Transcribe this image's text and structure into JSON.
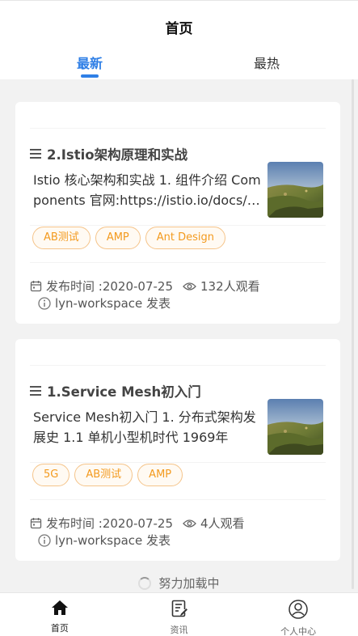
{
  "header": {
    "title": "首页",
    "tabs": [
      {
        "label": "最新",
        "active": true
      },
      {
        "label": "最热",
        "active": false
      }
    ]
  },
  "accent_color": "#2f7fe6",
  "tag_color": "#f39a1e",
  "articles": [
    {
      "title": "2.Istio架构原理和实战",
      "description": "Istio 核心架构和实战 1. 组件介绍 Components 官网:https://istio.io/docs/concepts/what-is-istio/",
      "tags": [
        "AB测试",
        "AMP",
        "Ant Design"
      ],
      "publish_label": "发布时间 :2020-07-25",
      "views_label": "132人观看",
      "author_label": "lyn-workspace 发表"
    },
    {
      "title": "1.Service Mesh初入门",
      "description": "Service Mesh初入门 1. 分布式架构发展史 1.1 单机小型机时代 1969年",
      "tags": [
        "5G",
        "AB测试",
        "AMP"
      ],
      "publish_label": "发布时间 :2020-07-25",
      "views_label": "4人观看",
      "author_label": "lyn-workspace 发表"
    }
  ],
  "loading_text": "努力加载中",
  "tabbar": [
    {
      "label": "首页",
      "icon": "home-icon",
      "active": true
    },
    {
      "label": "资讯",
      "icon": "news-icon",
      "active": false
    },
    {
      "label": "个人中心",
      "icon": "user-icon",
      "active": false
    }
  ]
}
